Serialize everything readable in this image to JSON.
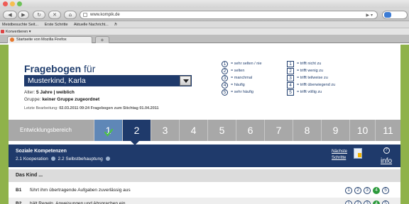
{
  "browser": {
    "url": "www.kompik.de",
    "bookmarks": [
      "Meistbesuchte Seit...",
      "Erste Schritte",
      "Aktuelle Nachricht...",
      "ℏ"
    ],
    "convert_label": "Konvertieren",
    "convert_chevron": "▾",
    "tab_label": "Startseite von Mozilla Firefox",
    "newtab_label": "+"
  },
  "form": {
    "title": "Fragebogen",
    "title_suffix": "für",
    "child": "Musterkind, Karla",
    "age_label": "Alter:",
    "age_value": "5 Jahre | weiblich",
    "group_label": "Gruppe:",
    "group_value": "keiner Gruppe zugeordnet",
    "last_edit_label": "Letzte Bearbeitung:",
    "last_edit_value": "02.03.2011 09:24",
    "stichtag": "Fragebogen zum Stichtag 01.04.2011"
  },
  "legend_frequency": [
    {
      "num": "1",
      "label": "= sehr selten / nie"
    },
    {
      "num": "2",
      "label": "= selten"
    },
    {
      "num": "3",
      "label": "= manchmal"
    },
    {
      "num": "4",
      "label": "= häufig"
    },
    {
      "num": "5",
      "label": "= sehr häufig"
    }
  ],
  "legend_agreement": [
    {
      "num": "1",
      "label": "= trifft nicht zu"
    },
    {
      "num": "2",
      "label": "= trifft wenig zu"
    },
    {
      "num": "3",
      "label": "= trifft teilweise zu"
    },
    {
      "num": "4",
      "label": "= trifft überwiegend zu"
    },
    {
      "num": "5",
      "label": "= trifft völlig zu"
    }
  ],
  "stepbar": {
    "label": "Entwicklungsbereich",
    "steps": [
      "1",
      "2",
      "3",
      "4",
      "5",
      "6",
      "7",
      "8",
      "9",
      "10",
      "11"
    ],
    "done_step": "1",
    "active_step": "2"
  },
  "section": {
    "title": "Soziale Kompetenzen",
    "sub1": "2.1 Kooperation",
    "sub2": "2.2 Selbstbehauptung",
    "next_line1": "Nächste",
    "next_line2": "Schritte",
    "info_q": "?",
    "info_label": "info"
  },
  "kind_label": "Das Kind ...",
  "rows": [
    {
      "code": "B1",
      "text": "führt ihm übertragende Aufgaben zuverlässig aus",
      "selected": 4
    },
    {
      "code": "B2",
      "text": "hält Regeln, Anweisungen und Absprachen ein",
      "selected": 4
    }
  ],
  "colors": {
    "brand_dark": "#1f3a6b",
    "selected_green": "#2c9a3c",
    "frame_green": "#8fb24a"
  }
}
